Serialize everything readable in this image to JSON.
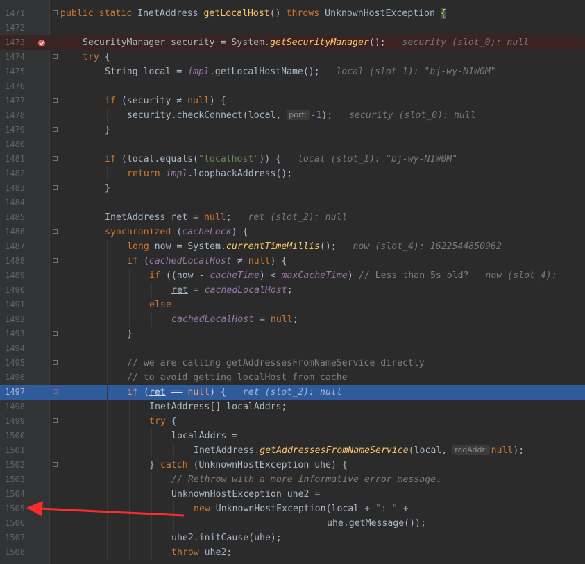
{
  "editor": {
    "lines": [
      {
        "n": "1471",
        "indent": 1,
        "fold": true,
        "html": "<span class='kw'>public static</span> InetAddress <span class='fn'>getLocalHost</span>() <span class='kw'>throws</span> UnknownHostException <span class='br'>{</span>"
      },
      {
        "n": "1472",
        "indent": 1,
        "fold": false,
        "html": ""
      },
      {
        "n": "1473",
        "indent": 2,
        "fold": false,
        "state": "bp",
        "html": "SecurityManager security = System.<span class='sm'>getSecurityManager</span>();<span class='ih'>   security (slot_0): null</span>"
      },
      {
        "n": "1474",
        "indent": 2,
        "fold": true,
        "html": "<span class='kw'>try</span> {"
      },
      {
        "n": "1475",
        "indent": 3,
        "fold": false,
        "html": "String local = <span class='st'>impl</span>.getLocalHostName();<span class='ih'>   local (slot_1): \"bj-wy-N1W0M\"</span>"
      },
      {
        "n": "1476",
        "indent": 3,
        "fold": false,
        "html": ""
      },
      {
        "n": "1477",
        "indent": 3,
        "fold": true,
        "html": "<span class='kw'>if</span> (security ≠ <span class='kw'>null</span>) {"
      },
      {
        "n": "1478",
        "indent": 4,
        "fold": false,
        "html": "security.checkConnect(local, <span class='hint' data-name='param-hint-port' data-interactable='false'>port:</span><span class='num'>-1</span>);<span class='ih'>   security (slot_0): null</span>"
      },
      {
        "n": "1479",
        "indent": 3,
        "fold": true,
        "html": "}"
      },
      {
        "n": "1480",
        "indent": 3,
        "fold": false,
        "html": ""
      },
      {
        "n": "1481",
        "indent": 3,
        "fold": true,
        "html": "<span class='kw'>if</span> (local.equals(<span class='str'>\"localhost\"</span>)) {<span class='ih'>   local (slot_1): \"bj-wy-N1W0M\"</span>"
      },
      {
        "n": "1482",
        "indent": 4,
        "fold": false,
        "html": "<span class='kw'>return</span> <span class='st'>impl</span>.loopbackAddress();"
      },
      {
        "n": "1483",
        "indent": 3,
        "fold": true,
        "html": "}"
      },
      {
        "n": "1484",
        "indent": 3,
        "fold": false,
        "html": ""
      },
      {
        "n": "1485",
        "indent": 3,
        "fold": false,
        "html": "InetAddress <span class='ul'>ret</span> = <span class='kw'>null</span>;<span class='ih'>   ret (slot_2): null</span>"
      },
      {
        "n": "1486",
        "indent": 3,
        "fold": true,
        "html": "<span class='kw'>synchronized</span> (<span class='st'>cacheLock</span>) {"
      },
      {
        "n": "1487",
        "indent": 4,
        "fold": false,
        "html": "<span class='kw'>long</span> now = System.<span class='sm'>currentTimeMillis</span>();<span class='ih'>   now (slot_4): 1622544850962</span>"
      },
      {
        "n": "1488",
        "indent": 4,
        "fold": true,
        "html": "<span class='kw'>if</span> (<span class='st'>cachedLocalHost</span> ≠ <span class='kw'>null</span>) {"
      },
      {
        "n": "1489",
        "indent": 5,
        "fold": false,
        "html": "<span class='kw'>if</span> ((now - <span class='st'>cacheTime</span>) &lt; <span class='st'>maxCacheTime</span>) <span class='cm'>// Less than 5s old?</span><span class='ih'>   now (slot_4):</span>"
      },
      {
        "n": "1490",
        "indent": 6,
        "fold": false,
        "html": "<span class='ul'>ret</span> = <span class='st'>cachedLocalHost</span>;"
      },
      {
        "n": "1491",
        "indent": 5,
        "fold": false,
        "html": "<span class='kw'>else</span>"
      },
      {
        "n": "1492",
        "indent": 6,
        "fold": false,
        "html": "<span class='st'>cachedLocalHost</span> = <span class='kw'>null</span>;"
      },
      {
        "n": "1493",
        "indent": 4,
        "fold": true,
        "html": "}"
      },
      {
        "n": "1494",
        "indent": 4,
        "fold": false,
        "html": ""
      },
      {
        "n": "1495",
        "indent": 4,
        "fold": true,
        "html": "<span class='cm'>// we are calling getAddressesFromNameService directly</span>"
      },
      {
        "n": "1496",
        "indent": 4,
        "fold": false,
        "html": "<span class='cm'>// to avoid getting localHost from cache</span>"
      },
      {
        "n": "1497",
        "indent": 4,
        "fold": true,
        "state": "exec",
        "html": "<span class='kw'>if</span> (<span class='ul'>ret</span> ══ <span class='kw'>null</span>) {<span class='ih'>   ret (slot_2): null</span>"
      },
      {
        "n": "1498",
        "indent": 5,
        "fold": false,
        "html": "InetAddress[] localAddrs;"
      },
      {
        "n": "1499",
        "indent": 5,
        "fold": true,
        "html": "<span class='kw'>try</span> {"
      },
      {
        "n": "1500",
        "indent": 6,
        "fold": false,
        "html": "localAddrs ="
      },
      {
        "n": "1501",
        "indent": 7,
        "fold": false,
        "html": "InetAddress.<span class='sm'>getAddressesFromNameService</span>(local, <span class='hint' data-name='param-hint-reqaddr' data-interactable='false'>reqAddr:</span><span class='kw'>null</span>);"
      },
      {
        "n": "1502",
        "indent": 5,
        "fold": true,
        "html": "} <span class='kw'>catch</span> (UnknownHostException uhe) {"
      },
      {
        "n": "1503",
        "indent": 6,
        "fold": false,
        "html": "<span class='cmi'>// Rethrow with a more informative error message.</span>"
      },
      {
        "n": "1504",
        "indent": 6,
        "fold": false,
        "html": "UnknownHostException uhe2 ="
      },
      {
        "n": "1505",
        "indent": 7,
        "fold": false,
        "html": "<span class='kw'>new</span> UnknownHostException(local + <span class='str'>\": \"</span> +"
      },
      {
        "n": "1506",
        "indent": 13,
        "fold": false,
        "html": "uhe.getMessage());"
      },
      {
        "n": "1507",
        "indent": 6,
        "fold": false,
        "html": "uhe2.initCause(uhe);"
      },
      {
        "n": "1508",
        "indent": 6,
        "fold": false,
        "html": "<span class='kw'>throw</span> uhe2;"
      }
    ]
  },
  "colors": {
    "background": "#2b2b2b",
    "gutter": "#313335",
    "execution_line": "#2d5b9c",
    "breakpoint_line": "#3a2323",
    "keyword": "#cc7832",
    "annotation_arrow": "#ff2a2a"
  },
  "icons": {
    "breakpoint": "breakpoint-icon",
    "fold": "fold-icon",
    "arrow": "red-arrow-annotation"
  }
}
